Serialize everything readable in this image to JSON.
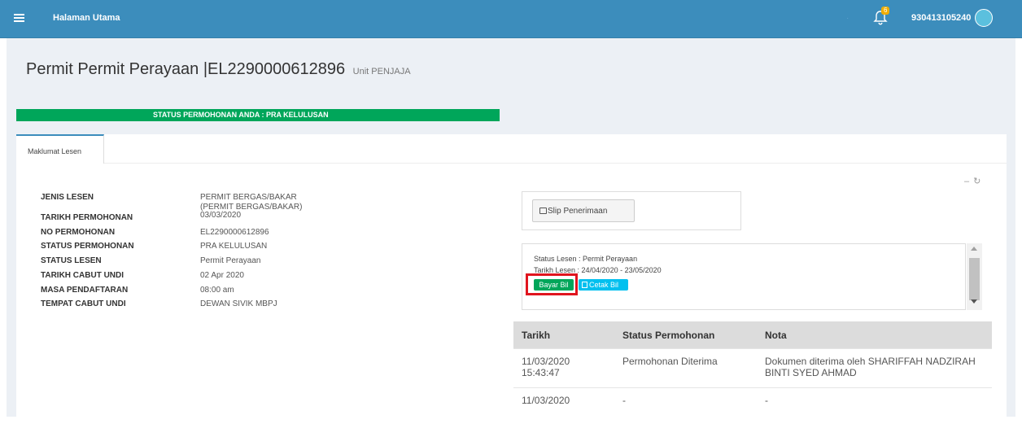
{
  "navbar": {
    "home_label": "Halaman Utama",
    "notification_count": "6",
    "user_id": "930413105240"
  },
  "page": {
    "title": "Permit Permit Perayaan |EL2290000612896",
    "subtitle": "Unit PENJAJA",
    "status_banner": "STATUS PERMOHONAN ANDA : PRA KELULUSAN"
  },
  "tabs": [
    {
      "label": "Maklumat Lesen"
    }
  ],
  "box_tools": {
    "collapse": "–",
    "refresh": "↻"
  },
  "license_info": [
    {
      "label": "JENIS LESEN",
      "value": "PERMIT BERGAS/BAKAR",
      "value2": "(PERMIT BERGAS/BAKAR)"
    },
    {
      "label": "TARIKH PERMOHONAN",
      "value": "03/03/2020"
    },
    {
      "label": "NO PERMOHONAN",
      "value": "EL2290000612896"
    },
    {
      "label": "STATUS PERMOHONAN",
      "value": "PRA KELULUSAN"
    },
    {
      "label": "STATUS LESEN",
      "value": "Permit Perayaan"
    },
    {
      "label": "TARIKH CABUT UNDI",
      "value": "02 Apr 2020"
    },
    {
      "label": "MASA PENDAFTARAN",
      "value": "08:00 am"
    },
    {
      "label": "TEMPAT CABUT UNDI",
      "value": "DEWAN SIVIK MBPJ"
    }
  ],
  "actions": {
    "slip_label": "Slip Penerimaan",
    "status_lesen_line": "Status Lesen : Permit Perayaan",
    "tarikh_lesen_line": "Tarikh Lesen : 24/04/2020 - 23/05/2020",
    "bayar_label": "Bayar Bil",
    "cetak_label": "Cetak Bil"
  },
  "history": {
    "headers": [
      "Tarikh",
      "Status Permohonan",
      "Nota"
    ],
    "rows": [
      {
        "date": "11/03/2020",
        "time": "15:43:47",
        "status": "Permohonan Diterima",
        "note": "Dokumen diterima oleh SHARIFFAH NADZIRAH BINTI SYED AHMAD"
      },
      {
        "date": "11/03/2020",
        "time": "",
        "status": "-",
        "note": "-"
      }
    ]
  },
  "colors": {
    "navbar": "#3c8dbc",
    "status_banner": "#00a65a",
    "bayar_button": "#00a65a",
    "cetak_button": "#00c0ef",
    "highlight": "#e0141e"
  },
  "icons": [
    "menu-icon",
    "bell-icon",
    "avatar",
    "printer-icon",
    "pdf-icon"
  ]
}
